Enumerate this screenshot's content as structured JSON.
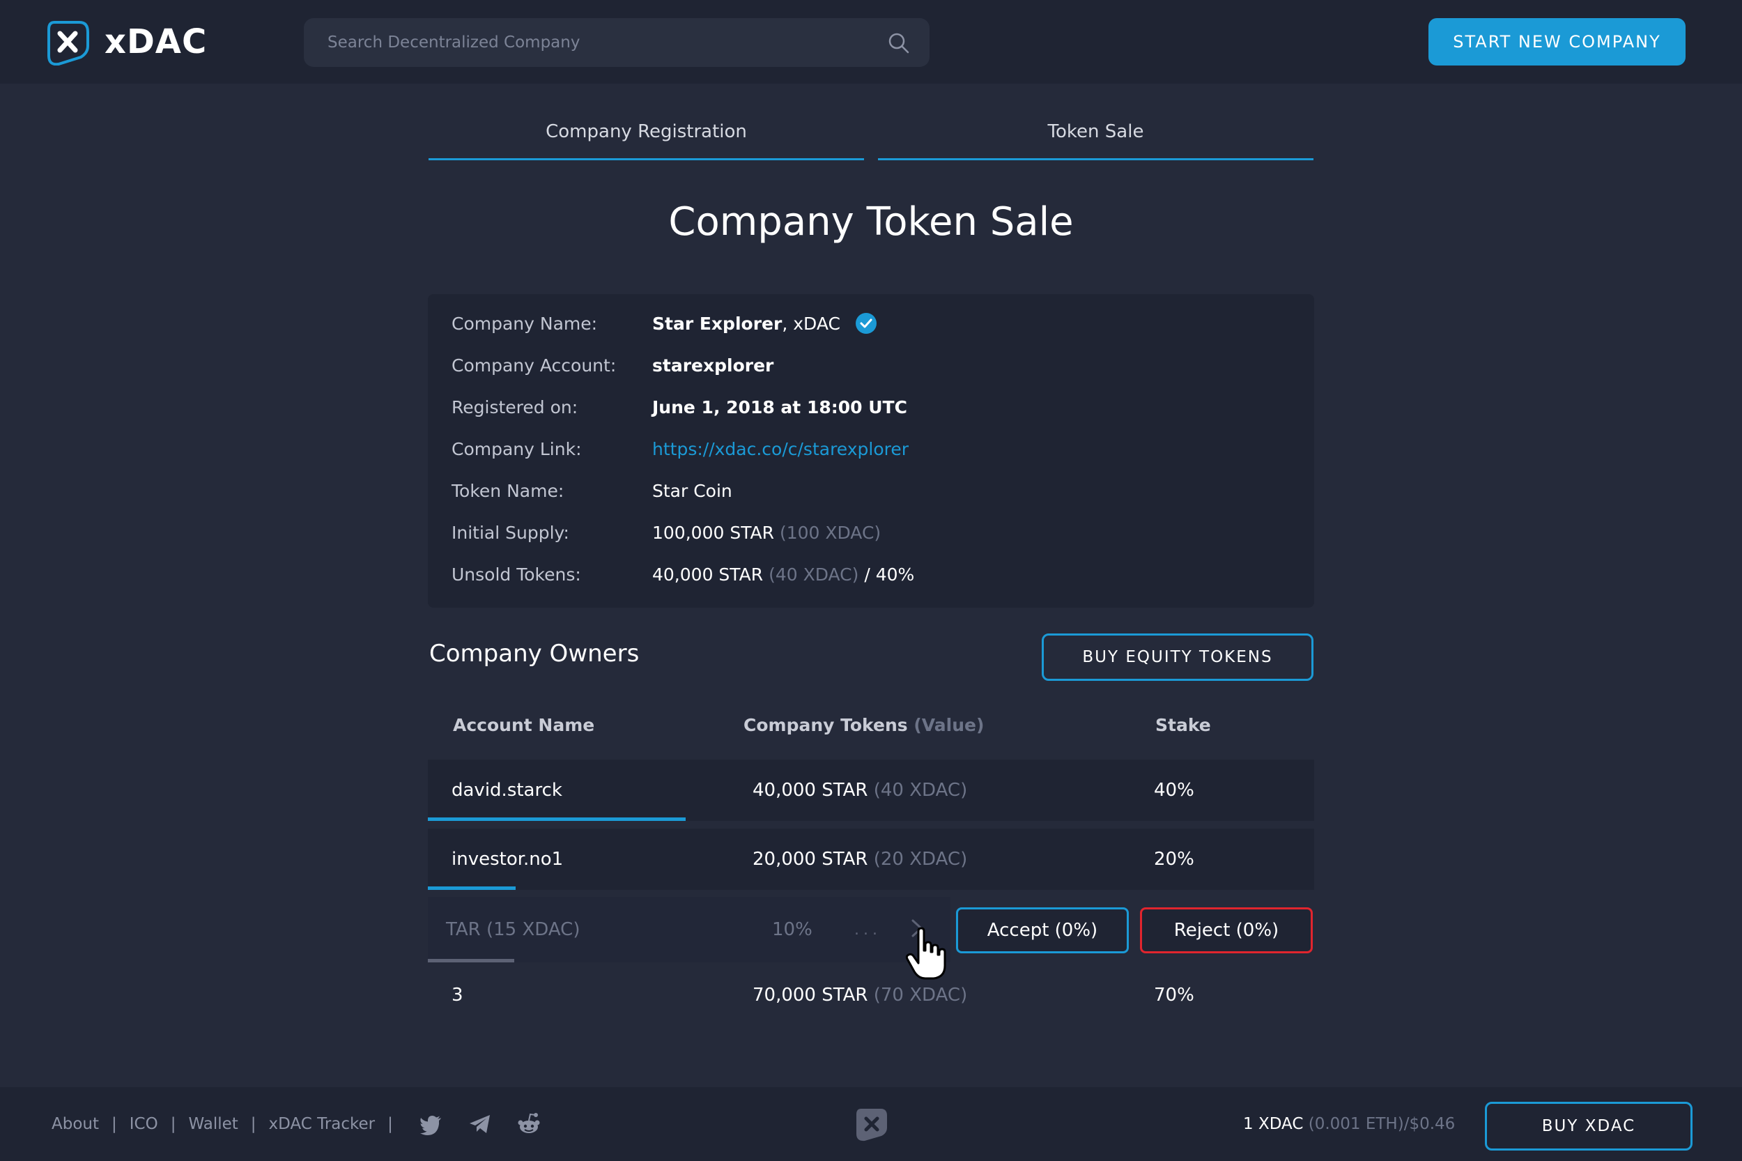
{
  "header": {
    "brand": "xDAC",
    "search_placeholder": "Search Decentralized Company",
    "start_button": "START NEW COMPANY"
  },
  "tabs": [
    {
      "label": "Company Registration"
    },
    {
      "label": "Token Sale"
    }
  ],
  "page_title": "Company Token Sale",
  "info": {
    "company_name_label": "Company Name:",
    "company_name_bold": "Star Explorer",
    "company_name_suffix": ", xDAC",
    "company_account_label": "Company Account:",
    "company_account": "starexplorer",
    "registered_label": "Registered on:",
    "registered": "June 1, 2018 at 18:00 UTC",
    "link_label": "Company Link:",
    "link": "https://xdac.co/c/starexplorer",
    "token_name_label": "Token Name:",
    "token_name": "Star Coin",
    "initial_supply_label": "Initial Supply:",
    "initial_supply": "100,000 STAR",
    "initial_supply_value": "(100 XDAC)",
    "unsold_label": "Unsold Tokens:",
    "unsold": "40,000 STAR",
    "unsold_value": "(40 XDAC)",
    "unsold_percent": "/ 40%"
  },
  "owners": {
    "title": "Company Owners",
    "buy_button": "BUY EQUITY TOKENS",
    "columns": {
      "account": "Account Name",
      "tokens": "Company Tokens",
      "tokens_value": "(Value)",
      "stake": "Stake"
    },
    "rows": [
      {
        "account": "david.starck",
        "tokens": "40,000 STAR",
        "value": "(40 XDAC)",
        "stake": "40%",
        "progress": 0.18
      },
      {
        "account": "investor.no1",
        "tokens": "20,000 STAR",
        "value": "(20 XDAC)",
        "stake": "20%",
        "progress": 0.06
      }
    ],
    "pending": {
      "tokens": "TAR (15 XDAC)",
      "stake": "10%",
      "dots": "...",
      "accept": "Accept (0%)",
      "reject": "Reject (0%)",
      "progress": 0.1
    },
    "total": {
      "account": "3",
      "tokens": "70,000 STAR",
      "value": "(70 XDAC)",
      "stake": "70%"
    }
  },
  "footer": {
    "links": [
      "About",
      "ICO",
      "Wallet",
      "xDAC Tracker"
    ],
    "separator": "|",
    "price_main": "1 XDAC",
    "price_sub": "(0.001 ETH)/$0.46",
    "buy_button": "BUY XDAC"
  },
  "colors": {
    "accent": "#1b9ad6",
    "danger": "#e0252e",
    "background": "#252a3a",
    "panel": "#1f2433"
  },
  "icons": [
    "xdac-logo-icon",
    "search-icon",
    "verified-icon",
    "chevron-right-icon",
    "hand-cursor-icon",
    "twitter-icon",
    "telegram-icon",
    "reddit-icon"
  ]
}
